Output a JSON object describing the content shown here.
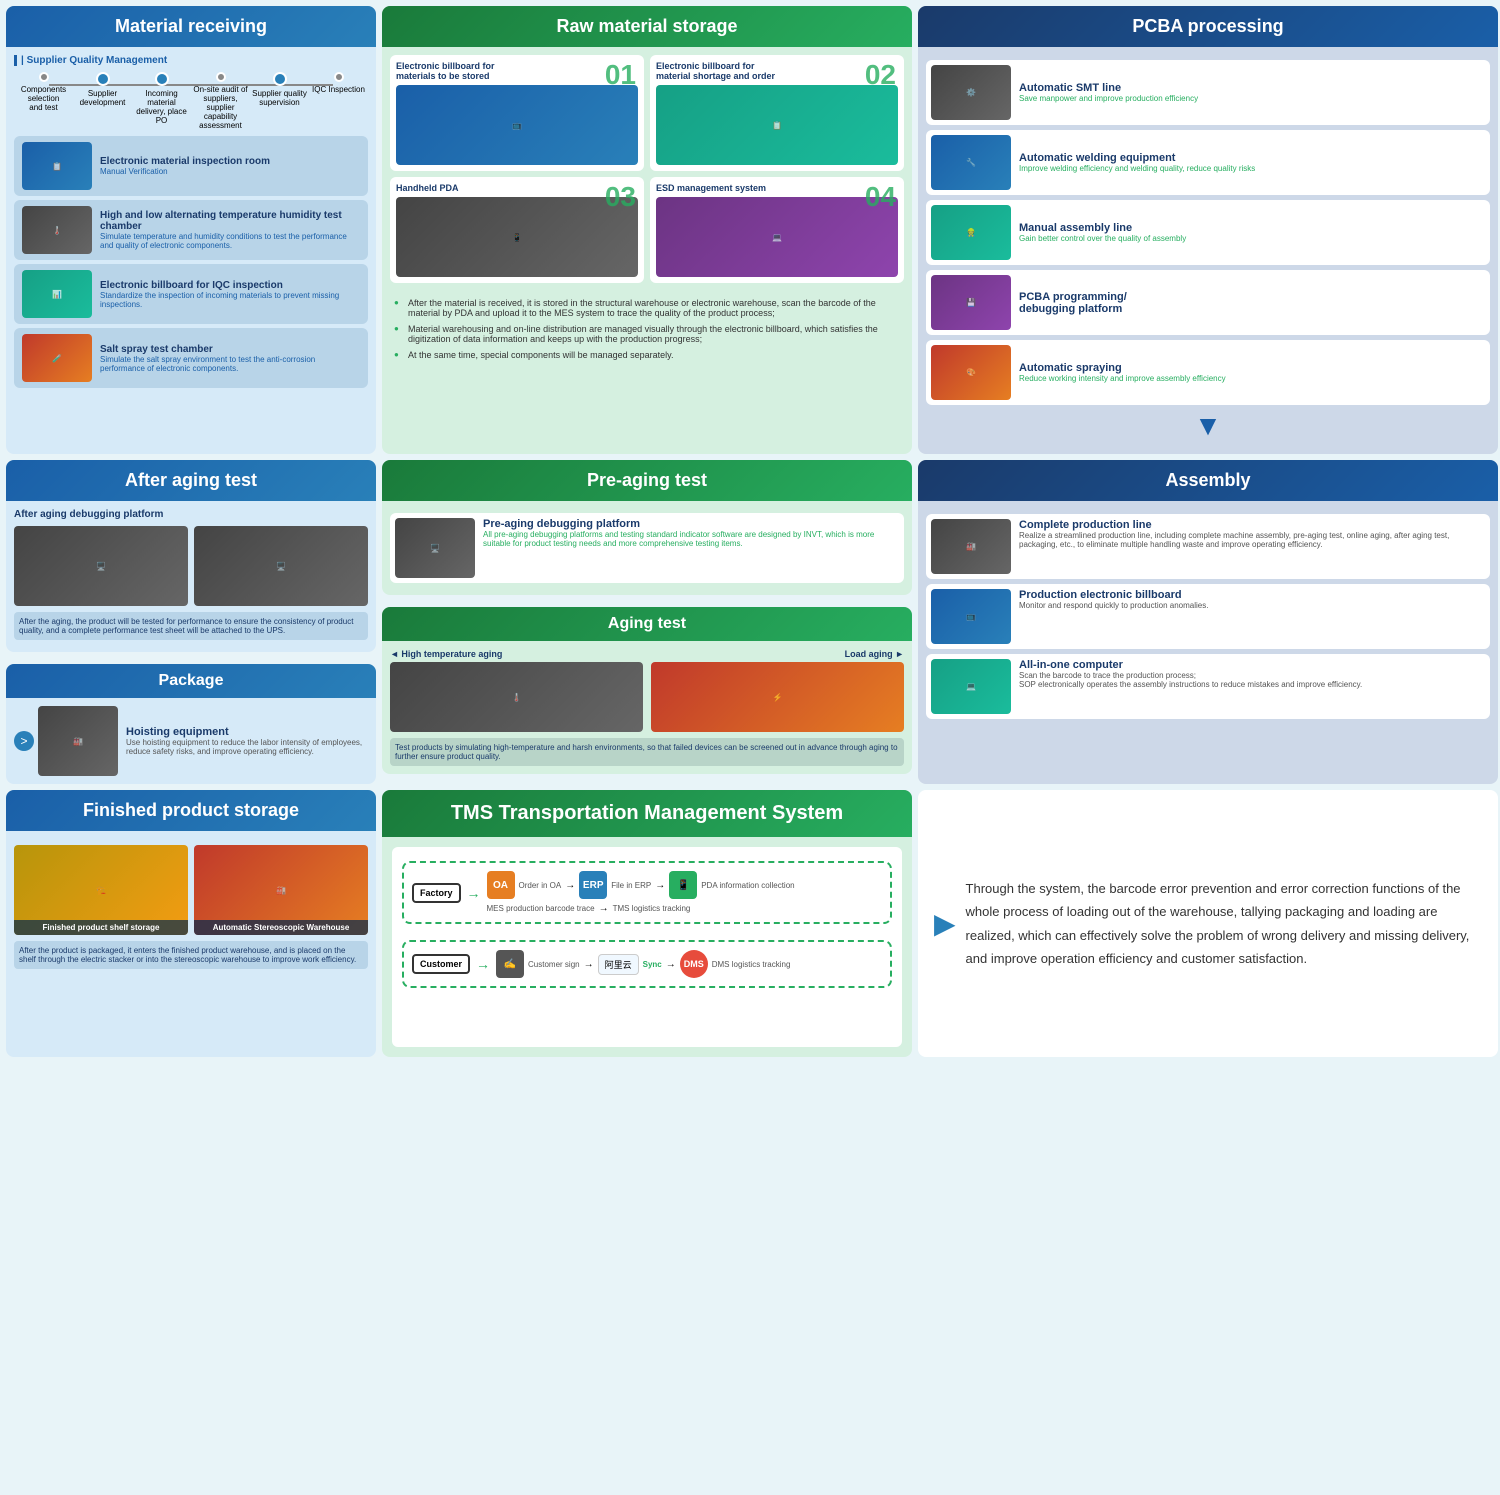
{
  "sections": {
    "material_receiving": {
      "title": "Material receiving",
      "supplier_quality": "| Supplier Quality Management",
      "timeline": [
        {
          "label": "Components selection\nand test"
        },
        {
          "label": "Supplier development"
        },
        {
          "label": "Incoming material delivery,\nplace PO"
        },
        {
          "label": "On-site audit of suppliers,\nsupplier capability assessment"
        },
        {
          "label": "Supplier quality\nsupervision"
        },
        {
          "label": "IQC Inspection"
        }
      ],
      "equipment": [
        {
          "name": "Electronic material inspection room",
          "desc": "Manual Verification"
        },
        {
          "name": "High and low alternating temperature humidity test chamber",
          "desc": "Simulate temperature and humidity conditions to test the performance and quality of electronic components."
        },
        {
          "name": "Electronic billboard for IQC inspection",
          "desc": "Standardize the inspection of incoming materials to prevent missing inspections."
        },
        {
          "name": "Salt spray test chamber",
          "desc": "Simulate the salt spray environment to test the anti-corrosion performance of electronic components."
        }
      ]
    },
    "raw_material_storage": {
      "title": "Raw material storage",
      "cards": [
        {
          "label": "Electronic billboard for materials to be stored",
          "num": "01"
        },
        {
          "label": "Electronic billboard for material shortage and order",
          "num": "02"
        },
        {
          "label": "Handheld PDA",
          "num": "03"
        },
        {
          "label": "ESD management system",
          "num": "04"
        }
      ],
      "bullets": [
        "After the material is received, it is stored in the structural warehouse or electronic warehouse, scan the barcode of the material by PDA and upload it to the MES system to trace the quality of the product process;",
        "Material warehousing and on-line distribution are managed visually through the electronic billboard, which satisfies the digitization of data information and keeps up with the production progress;",
        "At the same time, special components will be managed separately."
      ]
    },
    "pcba_processing": {
      "title": "PCBA processing",
      "items": [
        {
          "name": "Automatic SMT line",
          "desc": "Save manpower and improve production efficiency",
          "color": "green"
        },
        {
          "name": "Automatic welding equipment",
          "desc": "Improve welding efficiency and welding quality, reduce quality risks",
          "color": "blue"
        },
        {
          "name": "Manual assembly line",
          "desc": "Gain better control over the quality of assembly",
          "color": "green"
        },
        {
          "name": "PCBA programming/\ndebugging platform",
          "desc": "",
          "color": ""
        },
        {
          "name": "Automatic spraying",
          "desc": "Reduce working intensity and improve assembly efficiency",
          "color": "blue"
        }
      ]
    },
    "after_aging_test": {
      "title": "After aging test",
      "sub_title": "After aging debugging platform",
      "desc": "After the aging, the product will be tested for performance to ensure the consistency of product quality, and a complete performance test sheet will be attached to the UPS."
    },
    "package": {
      "title": "Package",
      "item_name": "Hoisting equipment",
      "item_desc": "Use hoisting equipment to reduce the labor intensity of employees, reduce safety risks, and improve operating efficiency."
    },
    "pre_aging_test": {
      "title": "Pre-aging test",
      "item_name": "Pre-aging debugging platform",
      "item_desc": "All pre-aging debugging platforms and testing standard indicator software are designed by INVT, which is more suitable for product testing needs and more comprehensive testing items."
    },
    "aging_test": {
      "title": "Aging test",
      "high_temp": "◄ High temperature aging",
      "load": "Load aging ►",
      "desc": "Test products by simulating high-temperature and harsh environments, so that failed devices can be screened out in advance through aging to further ensure product quality."
    },
    "assembly": {
      "title": "Assembly",
      "items": [
        {
          "name": "Complete production line",
          "desc": "Realize a streamlined production line, including complete machine assembly, pre-aging test, online aging, after aging test, packaging, etc., to eliminate multiple handling waste and improve operating efficiency."
        },
        {
          "name": "Production electronic billboard",
          "desc": "Monitor and respond quickly to production anomalies."
        },
        {
          "name": "All-in-one computer",
          "desc": "Scan the barcode to trace the production process;\nSOP electronically operates the assembly instructions to reduce mistakes and improve efficiency."
        }
      ]
    },
    "finished_product_storage": {
      "title": "Finished product storage",
      "items": [
        {
          "name": "Finished product shelf storage"
        },
        {
          "name": "Automatic Stereoscopic Warehouse"
        }
      ],
      "desc": "After the product is packaged, it enters the finished product warehouse, and is placed on the shelf through the electric stacker or into the stereoscopic warehouse to improve work efficiency."
    },
    "tms": {
      "title": "TMS Transportation\nManagement System",
      "flow": {
        "factory_label": "Factory",
        "customer_label": "Customer",
        "steps_top": [
          "Order in OA",
          "File in ERP",
          "PDA information collection",
          "MES production barcode trace",
          "TMS logistics tracking"
        ],
        "steps_bottom": [
          "Customer sign",
          "DMS logistics tracking"
        ],
        "cloud": "阿里云",
        "sync": "Sync",
        "dms": "DMS"
      },
      "description": "Through the system, the barcode error prevention and error correction functions of the whole process of loading out of the warehouse, tallying packaging and loading are realized, which can effectively solve the problem of wrong delivery and missing delivery, and improve operation efficiency and customer satisfaction."
    }
  }
}
